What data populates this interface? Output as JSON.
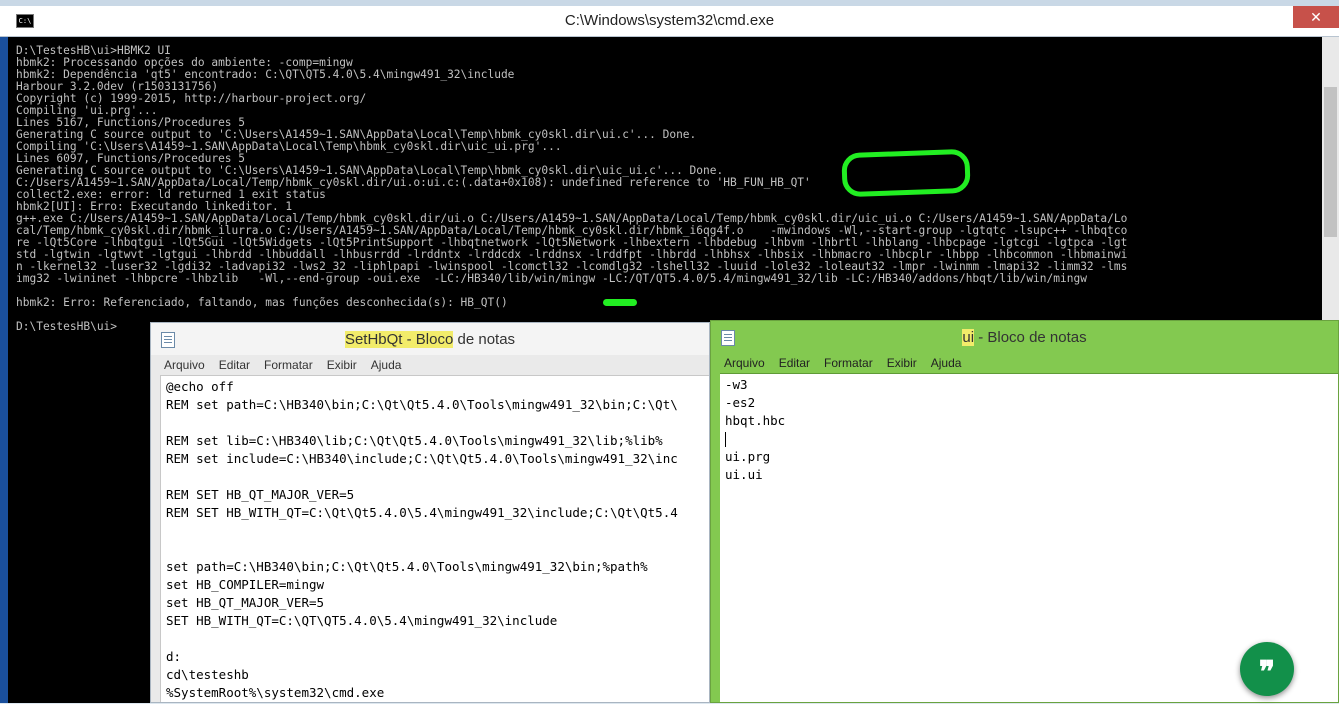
{
  "cmd": {
    "title": "C:\\Windows\\system32\\cmd.exe",
    "icon_text": "C:\\",
    "close_symbol": "✕",
    "lines": [
      "D:\\TestesHB\\ui>HBMK2 UI",
      "hbmk2: Processando opções do ambiente: -comp=mingw",
      "hbmk2: Dependência 'qt5' encontrado: C:\\QT\\QT5.4.0\\5.4\\mingw491_32\\include",
      "Harbour 3.2.0dev (r1503131756)",
      "Copyright (c) 1999-2015, http://harbour-project.org/",
      "Compiling 'ui.prg'...",
      "Lines 5167, Functions/Procedures 5",
      "Generating C source output to 'C:\\Users\\A1459~1.SAN\\AppData\\Local\\Temp\\hbmk_cy0skl.dir\\ui.c'... Done.",
      "Compiling 'C:\\Users\\A1459~1.SAN\\AppData\\Local\\Temp\\hbmk_cy0skl.dir\\uic_ui.prg'...",
      "Lines 6097, Functions/Procedures 5",
      "Generating C source output to 'C:\\Users\\A1459~1.SAN\\AppData\\Local\\Temp\\hbmk_cy0skl.dir\\uic_ui.c'... Done.",
      "C:/Users/A1459~1.SAN/AppData/Local/Temp/hbmk_cy0skl.dir/ui.o:ui.c:(.data+0x108): undefined reference to 'HB_FUN_HB_QT'",
      "collect2.exe: error: ld returned 1 exit status",
      "hbmk2[UI]: Erro: Executando linkeditor. 1",
      "g++.exe C:/Users/A1459~1.SAN/AppData/Local/Temp/hbmk_cy0skl.dir/ui.o C:/Users/A1459~1.SAN/AppData/Local/Temp/hbmk_cy0skl.dir/uic_ui.o C:/Users/A1459~1.SAN/AppData/Lo",
      "cal/Temp/hbmk_cy0skl.dir/hbmk_ilurra.o C:/Users/A1459~1.SAN/AppData/Local/Temp/hbmk_cy0skl.dir/hbmk_i6qg4f.o    -mwindows -Wl,--start-group -lgtqtc -lsupc++ -lhbqtco",
      "re -lQt5Core -lhbqtgui -lQt5Gui -lQt5Widgets -lQt5PrintSupport -lhbqtnetwork -lQt5Network -lhbextern -lhbdebug -lhbvm -lhbrtl -lhblang -lhbcpage -lgtcgi -lgtpca -lgt",
      "std -lgtwin -lgtwvt -lgtgui -lhbrdd -lhbuddall -lhbusrrdd -lrddntx -lrddcdx -lrddnsx -lrddfpt -lhbrdd -lhbhsx -lhbsix -lhbmacro -lhbcplr -lhbpp -lhbcommon -lhbmainwi",
      "n -lkernel32 -luser32 -lgdi32 -ladvapi32 -lws2_32 -liphlpapi -lwinspool -lcomctl32 -lcomdlg32 -lshell32 -luuid -lole32 -loleaut32 -lmpr -lwinmm -lmapi32 -limm32 -lms",
      "img32 -lwininet -lhbpcre -lhbzlib   -Wl,--end-group -oui.exe  -LC:/HB340/lib/win/mingw -LC:/QT/QT5.4.0/5.4/mingw491_32/lib -LC:/HB340/addons/hbqt/lib/win/mingw",
      "",
      "hbmk2: Erro: Referenciado, faltando, mas funções desconhecida(s): HB_QT()",
      "",
      "D:\\TestesHB\\ui>"
    ]
  },
  "notepad_left": {
    "title_highlight": "SetHbQt - Bloco",
    "title_rest": " de notas",
    "menu": [
      "Arquivo",
      "Editar",
      "Formatar",
      "Exibir",
      "Ajuda"
    ],
    "lines": [
      "@echo off",
      "REM set path=C:\\HB340\\bin;C:\\Qt\\Qt5.4.0\\Tools\\mingw491_32\\bin;C:\\Qt\\",
      "",
      "REM set lib=C:\\HB340\\lib;C:\\Qt\\Qt5.4.0\\Tools\\mingw491_32\\lib;%lib%",
      "REM set include=C:\\HB340\\include;C:\\Qt\\Qt5.4.0\\Tools\\mingw491_32\\inc",
      "",
      "REM SET HB_QT_MAJOR_VER=5",
      "REM SET HB_WITH_QT=C:\\Qt\\Qt5.4.0\\5.4\\mingw491_32\\include;C:\\Qt\\Qt5.4",
      "",
      "",
      "set path=C:\\HB340\\bin;C:\\Qt\\Qt5.4.0\\Tools\\mingw491_32\\bin;%path%",
      "set HB_COMPILER=mingw",
      "set HB_QT_MAJOR_VER=5",
      "SET HB_WITH_QT=C:\\QT\\QT5.4.0\\5.4\\mingw491_32\\include",
      "",
      "d:",
      "cd\\testeshb",
      "%SystemRoot%\\system32\\cmd.exe"
    ]
  },
  "notepad_right": {
    "title_highlight": "ui",
    "title_rest": " - Bloco de notas",
    "menu": [
      "Arquivo",
      "Editar",
      "Formatar",
      "Exibir",
      "Ajuda"
    ],
    "lines": [
      "-w3",
      "-es2",
      "hbqt.hbc",
      "",
      "ui.prg",
      "ui.ui"
    ]
  },
  "fab": {
    "symbol": "❞"
  }
}
